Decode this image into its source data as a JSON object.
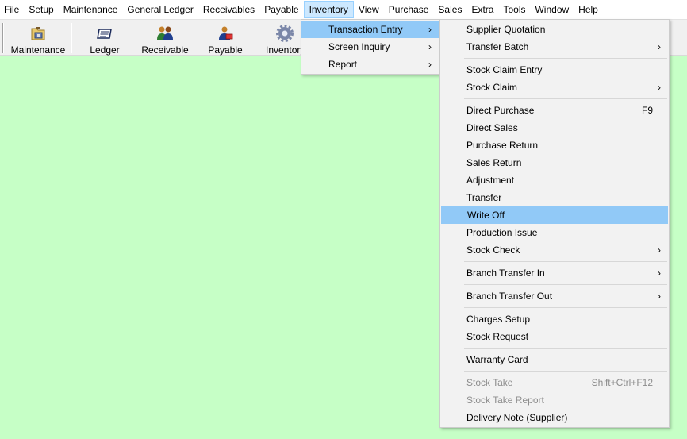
{
  "menubar": {
    "items": [
      "File",
      "Setup",
      "Maintenance",
      "General Ledger",
      "Receivables",
      "Payable",
      "Inventory",
      "View",
      "Purchase",
      "Sales",
      "Extra",
      "Tools",
      "Window",
      "Help"
    ],
    "active": "Inventory"
  },
  "toolbar": {
    "maintenance": "Maintenance",
    "ledger": "Ledger",
    "receivable": "Receivable",
    "payable": "Payable",
    "inventory": "Inventory"
  },
  "inventory_menu": {
    "transaction_entry": "Transaction Entry",
    "screen_inquiry": "Screen Inquiry",
    "report": "Report"
  },
  "transaction_menu": {
    "supplier_quotation": "Supplier Quotation",
    "transfer_batch": "Transfer Batch",
    "stock_claim_entry": "Stock Claim Entry",
    "stock_claim": "Stock Claim",
    "direct_purchase": "Direct Purchase",
    "direct_purchase_shortcut": "F9",
    "direct_sales": "Direct Sales",
    "purchase_return": "Purchase Return",
    "sales_return": "Sales Return",
    "adjustment": "Adjustment",
    "transfer": "Transfer",
    "write_off": "Write Off",
    "production_issue": "Production Issue",
    "stock_check": "Stock Check",
    "branch_transfer_in": "Branch Transfer In",
    "branch_transfer_out": "Branch Transfer Out",
    "charges_setup": "Charges Setup",
    "stock_request": "Stock Request",
    "warranty_card": "Warranty Card",
    "stock_take": "Stock Take",
    "stock_take_shortcut": "Shift+Ctrl+F12",
    "stock_take_report": "Stock Take Report",
    "delivery_note_supplier": "Delivery Note (Supplier)"
  },
  "icons": {
    "submenu_arrow": "chevron-right-icon",
    "maintenance": "folder-toolbox-icon",
    "ledger": "ledger-book-icon",
    "receivable": "people-group-icon",
    "payable": "person-money-icon",
    "inventory": "gear-icon"
  },
  "colors": {
    "workspace_bg": "#c6ffc6",
    "menu_highlight": "#91c9f7",
    "menubar_active": "#cce8ff"
  }
}
